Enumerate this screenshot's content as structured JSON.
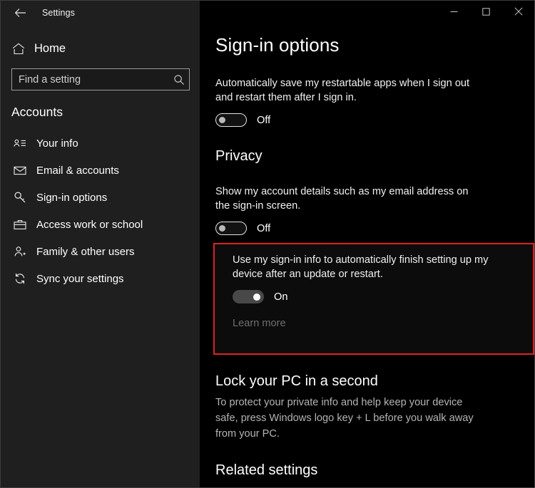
{
  "window": {
    "app_title": "Settings",
    "back_icon": "back-arrow-icon",
    "controls": {
      "minimize": "minimize-icon",
      "maximize": "maximize-icon",
      "close": "close-icon"
    }
  },
  "sidebar": {
    "home": {
      "label": "Home",
      "icon": "home-icon"
    },
    "search": {
      "placeholder": "Find a setting",
      "value": "",
      "icon": "search-icon"
    },
    "category": "Accounts",
    "items": [
      {
        "label": "Your info",
        "icon": "contact-card-icon",
        "selected": false
      },
      {
        "label": "Email & accounts",
        "icon": "mail-icon",
        "selected": false
      },
      {
        "label": "Sign-in options",
        "icon": "key-icon",
        "selected": true
      },
      {
        "label": "Access work or school",
        "icon": "briefcase-icon",
        "selected": false
      },
      {
        "label": "Family & other users",
        "icon": "person-add-icon",
        "selected": false
      },
      {
        "label": "Sync your settings",
        "icon": "sync-icon",
        "selected": false
      }
    ]
  },
  "main": {
    "page_title": "Sign-in options",
    "restartable_apps": {
      "description": "Automatically save my restartable apps when I sign out and restart them after I sign in.",
      "toggle_state": "Off",
      "toggle_on": false
    },
    "privacy": {
      "heading": "Privacy",
      "account_details": {
        "description": "Show my account details such as my email address on the sign-in screen.",
        "toggle_state": "Off",
        "toggle_on": false
      },
      "finish_setup": {
        "description": "Use my sign-in info to automatically finish setting up my device after an update or restart.",
        "toggle_state": "On",
        "toggle_on": true,
        "learn_more": "Learn more",
        "highlighted": true,
        "highlight_color": "#e02020"
      }
    },
    "lock_pc": {
      "heading": "Lock your PC in a second",
      "body": "To protect your private info and help keep your device safe, press Windows logo key + L before you walk away from your PC."
    },
    "related_settings": {
      "heading": "Related settings"
    }
  }
}
